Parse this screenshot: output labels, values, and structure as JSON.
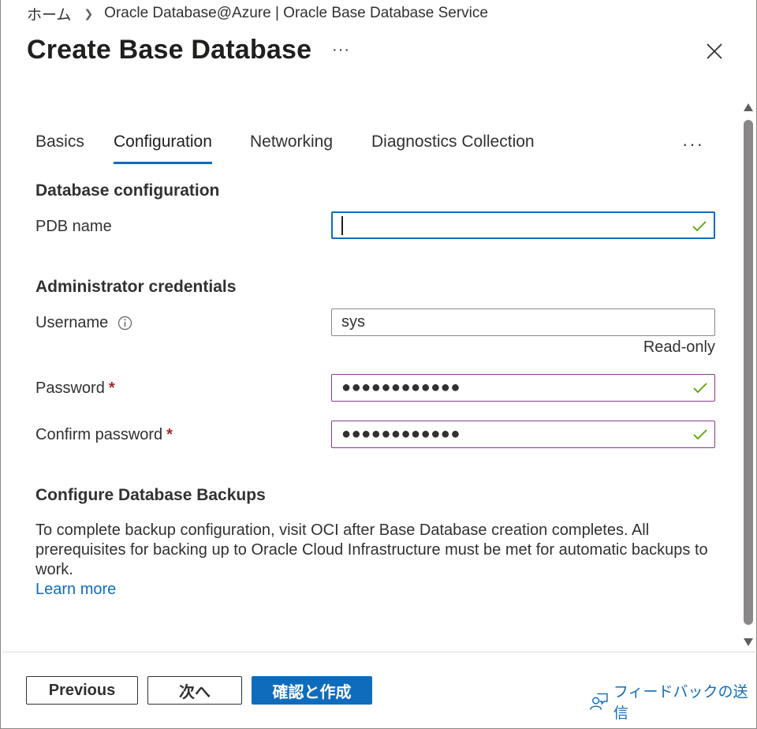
{
  "breadcrumb": {
    "home": "ホーム",
    "current": "Oracle Database@Azure | Oracle Base Database Service"
  },
  "header": {
    "title": "Create Base Database",
    "more": "···"
  },
  "tabs": [
    {
      "label": "Basics"
    },
    {
      "label": "Configuration"
    },
    {
      "label": "Networking"
    },
    {
      "label": "Diagnostics Collection"
    }
  ],
  "tabs_more": "···",
  "database_configuration": {
    "heading": "Database configuration",
    "pdb_name_label": "PDB name",
    "pdb_name_value": ""
  },
  "admin_credentials": {
    "heading": "Administrator credentials",
    "username_label": "Username",
    "username_value": "sys",
    "username_note": "Read-only",
    "password_label": "Password",
    "password_value": "●●●●●●●●●●●●",
    "confirm_label": "Confirm password",
    "confirm_value": "●●●●●●●●●●●●",
    "required_marker": "*"
  },
  "backups": {
    "heading": "Configure Database Backups",
    "description": "To complete backup configuration, visit OCI after Base Database creation completes. All prerequisites for backing up to Oracle Cloud Infrastructure must be met for automatic backups to work.",
    "link": "Learn more"
  },
  "footer": {
    "previous": "Previous",
    "next": "次へ",
    "review_create": "確認と作成",
    "feedback": "フィードバックの送信"
  },
  "colors": {
    "accent": "#0f6cbd",
    "valid": "#57a300",
    "required": "#a4262c",
    "focus_border": "#0f6cbd",
    "password_border": "#8a3b91"
  },
  "icons": {
    "close": "close-icon",
    "info": "info-icon",
    "check": "check-icon",
    "feedback": "feedback-icon"
  }
}
